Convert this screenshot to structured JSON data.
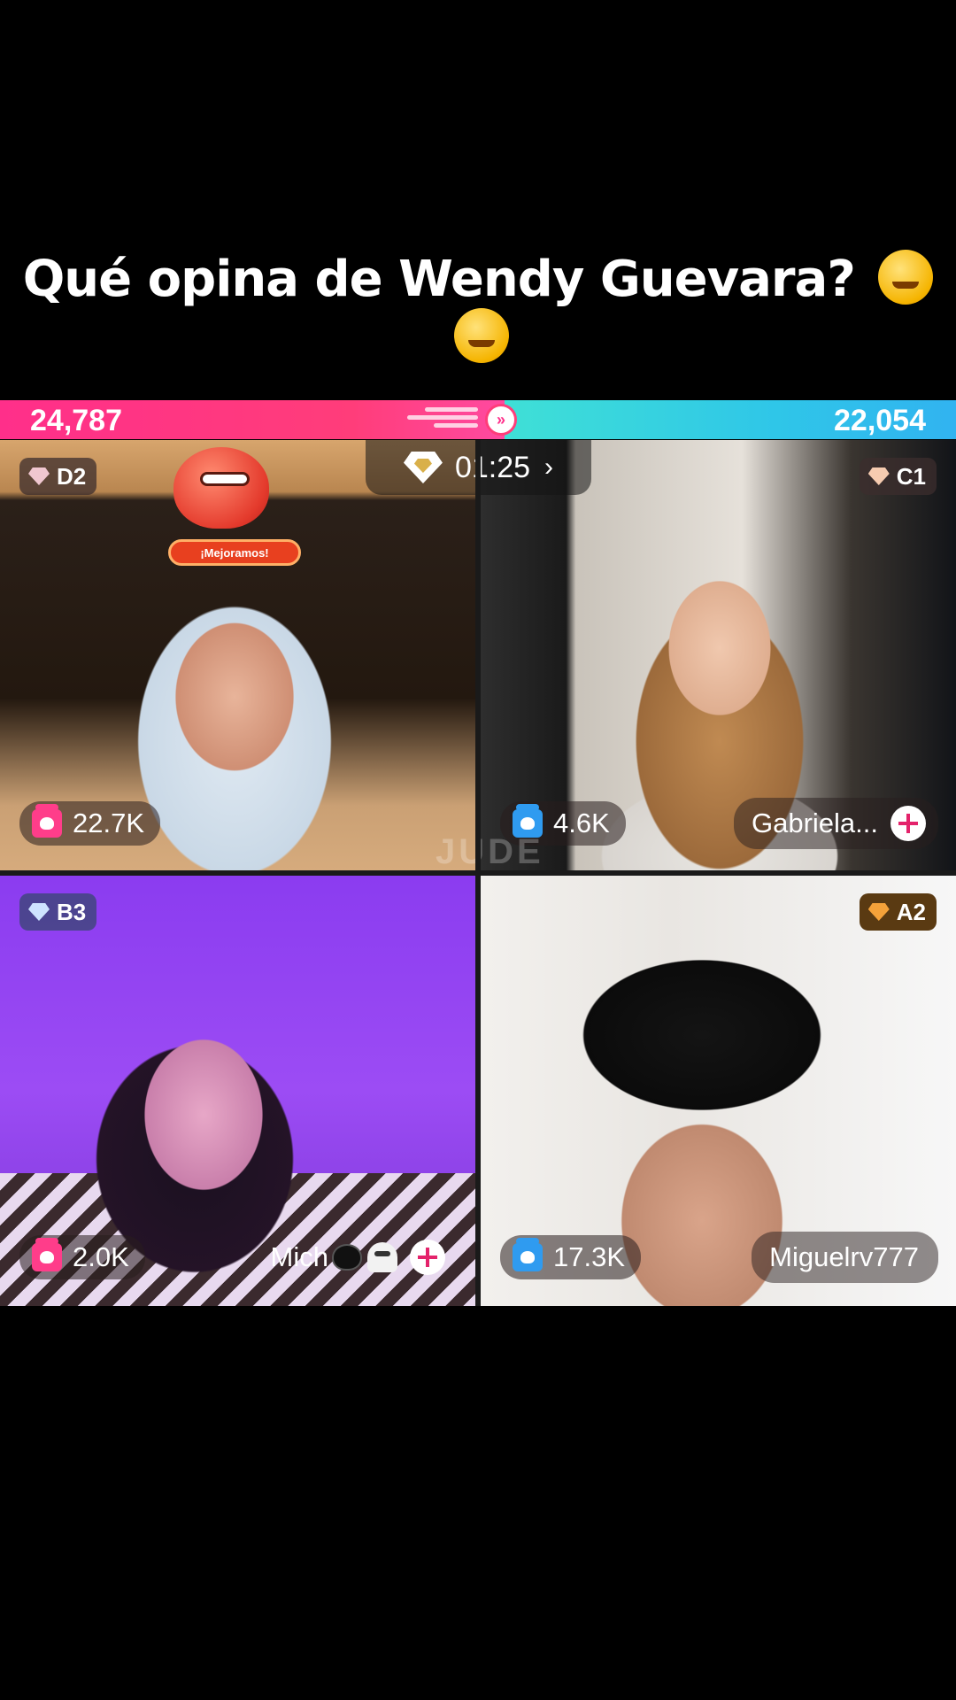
{
  "caption": {
    "text": "Qué opina de Wendy Guevara?"
  },
  "battle": {
    "left_score": "24,787",
    "right_score": "22,054",
    "left_color": "#ff2f8a",
    "right_color": "#31b3f0"
  },
  "timer": {
    "value": "01:25"
  },
  "sticker": {
    "label": "¡Mejoramos!"
  },
  "watermark": "JUDE",
  "tiles": [
    {
      "rank": "D2",
      "gifts": "22.7K",
      "gift_color": "pink",
      "name": ""
    },
    {
      "rank": "C1",
      "gifts": "4.6K",
      "gift_color": "blue",
      "name": "Gabriela..."
    },
    {
      "rank": "B3",
      "gifts": "2.0K",
      "gift_color": "pink",
      "name": "Mich"
    },
    {
      "rank": "A2",
      "gifts": "17.3K",
      "gift_color": "blue",
      "name": "Miguelrv777"
    }
  ]
}
